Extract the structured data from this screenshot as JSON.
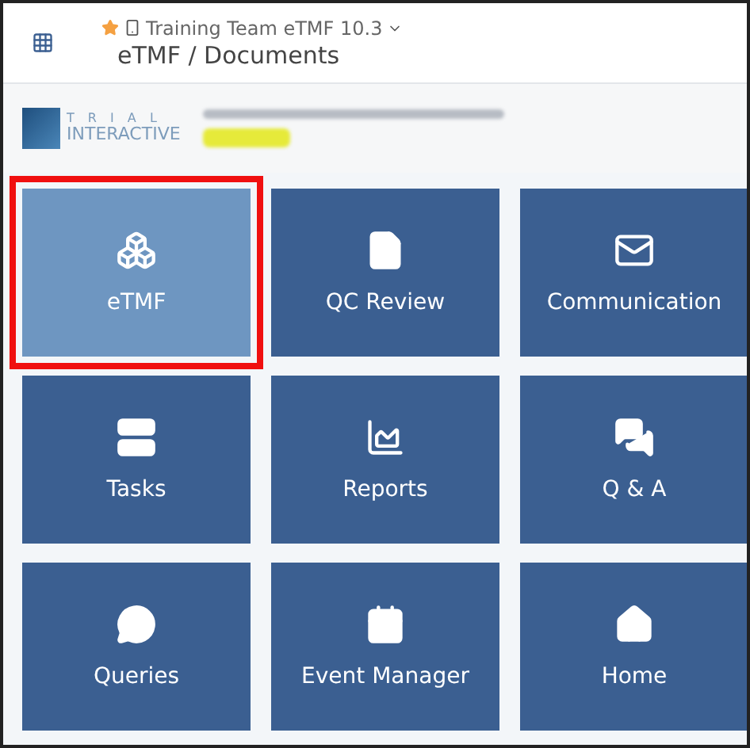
{
  "header": {
    "study": "Training Team eTMF 10.3",
    "breadcrumb": "eTMF / Documents"
  },
  "logo": {
    "top": "T R I A L",
    "bottom": "INTERACTIVE"
  },
  "tiles": [
    {
      "label": "eTMF",
      "kind": "cubes",
      "selected": true
    },
    {
      "label": "QC Review",
      "kind": "file",
      "selected": false
    },
    {
      "label": "Communication",
      "kind": "mail",
      "selected": false
    },
    {
      "label": "Tasks",
      "kind": "server",
      "selected": false
    },
    {
      "label": "Reports",
      "kind": "chart",
      "selected": false
    },
    {
      "label": "Q & A",
      "kind": "chat",
      "selected": false
    },
    {
      "label": "Queries",
      "kind": "bubbles",
      "selected": false
    },
    {
      "label": "Event Manager",
      "kind": "calendar",
      "selected": false
    },
    {
      "label": "Home",
      "kind": "home",
      "selected": false
    }
  ]
}
